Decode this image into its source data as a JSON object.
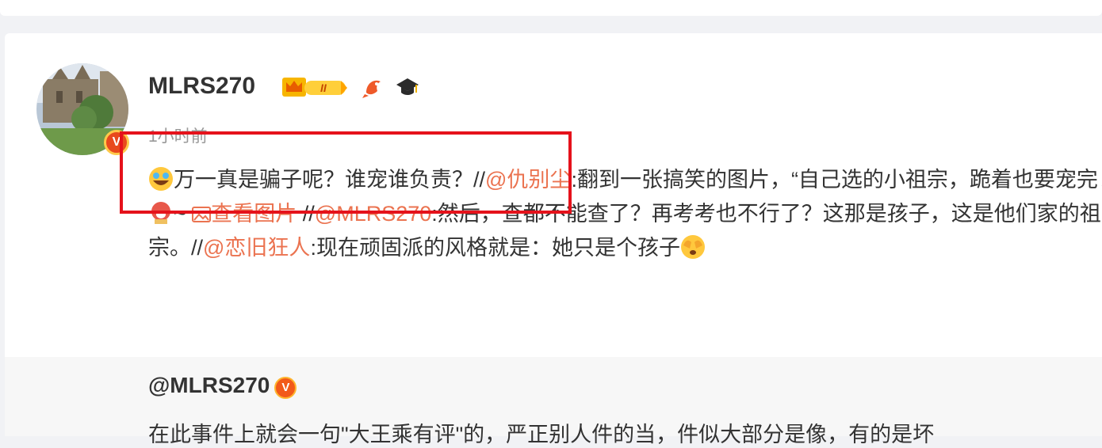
{
  "post": {
    "username": "MLRS270",
    "timestamp": "1小时前",
    "avatar_badge": "V",
    "text": {
      "part1": "万一真是骗子呢？谁宠谁负责？//",
      "mention1": "@仇别尘",
      "part2": ":翻到一张搞笑的图片，“自己选的小祖宗，跪着也要宠完！” ",
      "part3": "~ ",
      "view_image": "查看图片",
      "part4": " //",
      "mention2": "@MLRS270",
      "part5": ":然后，查都不能查了？再考考也不行了？这那是孩子，这是他们家的祖宗。//",
      "mention3": "@恋旧狂人",
      "part6": ":现在顽固派的风格就是：她只是个孩子"
    }
  },
  "quoted": {
    "username": "@MLRS270",
    "badge": "V",
    "text_preview": "在此事件上就会一句\"大王乘有评\"的，严正别人件的当，件似大部分是像，有的是坏"
  },
  "colors": {
    "accent": "#eb7350",
    "highlight": "#e5121b"
  }
}
